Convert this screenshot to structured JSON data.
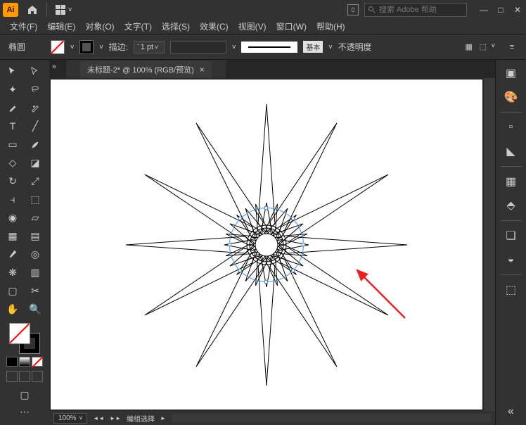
{
  "titlebar": {
    "app_abbrev": "Ai",
    "search_placeholder": "搜索 Adobe 帮助"
  },
  "menubar": {
    "items": [
      "文件(F)",
      "编辑(E)",
      "对象(O)",
      "文字(T)",
      "选择(S)",
      "效果(C)",
      "视图(V)",
      "窗口(W)",
      "帮助(H)"
    ]
  },
  "controlbar": {
    "selection_label": "椭圆",
    "stroke_label": "描边:",
    "stroke_value": "1 pt",
    "style_label": "基本",
    "opacity_label": "不透明度"
  },
  "document": {
    "tab_title": "未标题-2* @ 100% (RGB/预览)",
    "zoom": "100%",
    "status": "编组选择"
  },
  "window": {
    "minimize": "—",
    "maximize": "□",
    "close": "✕"
  }
}
